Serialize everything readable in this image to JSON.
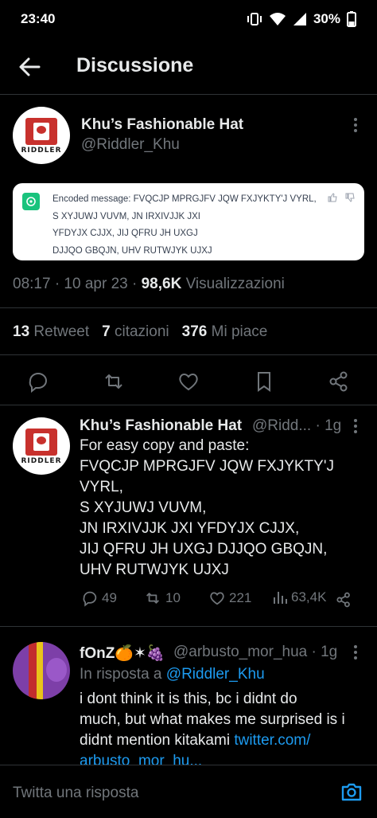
{
  "status_bar": {
    "time": "23:40",
    "battery": "30%"
  },
  "header": {
    "title": "Discussione"
  },
  "tweet": {
    "avatar_text": "RIDDLER",
    "name": "Khu’s Fashionable Hat",
    "handle": "@Riddler_Khu",
    "encoded_lines": [
      "Encoded message: FVQCJP MPRGJFV JQW FXJYKTY'J VYRL,",
      "S XYJUWJ VUVM, JN IRXIVJJK JXI",
      "YFDYJX CJJX, JIJ QFRU JH UXGJ",
      "DJJQO GBQJN, UHV RUTWJYK UJXJ"
    ],
    "time_date": "08:17 · 10 apr 23 · ",
    "views_count": "98,6K",
    "views_label": " Visualizzazioni",
    "retweets_count": "13",
    "retweets_label": "Retweet",
    "quotes_count": "7",
    "quotes_label": "citazioni",
    "likes_count": "376",
    "likes_label": "Mi piace"
  },
  "reply1": {
    "avatar_text": "RIDDLER",
    "name": "Khu’s Fashionable Hat",
    "handle_time": "@Ridd... · 1g",
    "lines": [
      "For easy copy and paste:",
      "FVQCJP MPRGJFV JQW FXJYKTY'J",
      "VYRL,",
      "S XYJUWJ VUVM,",
      "JN IRXIVJJK JXI YFDYJX CJJX,",
      "JIJ QFRU JH UXGJ DJJQO GBQJN,",
      "UHV RUTWJYK UJXJ"
    ],
    "replies": "49",
    "retweets": "10",
    "likes": "221",
    "views": "63,4K"
  },
  "reply2": {
    "name": "fOnZ🍊✶🍇",
    "handle_time": "@arbusto_mor_hua · 1g",
    "in_reply_prefix": "In risposta a ",
    "in_reply_handle": "@Riddler_Khu",
    "lines": [
      "i dont think it is this, bc i didnt do",
      "much, but what makes me surprised is i",
      "didnt mention kitakami "
    ],
    "link1": "twitter.com/",
    "link2": "arbusto_mor_hu..."
  },
  "reply_bar": {
    "placeholder": "Twitta una risposta"
  },
  "colors": {
    "accent": "#1d9bf0",
    "muted": "#71767b",
    "text": "#e7e9ea",
    "background": "#000000"
  }
}
